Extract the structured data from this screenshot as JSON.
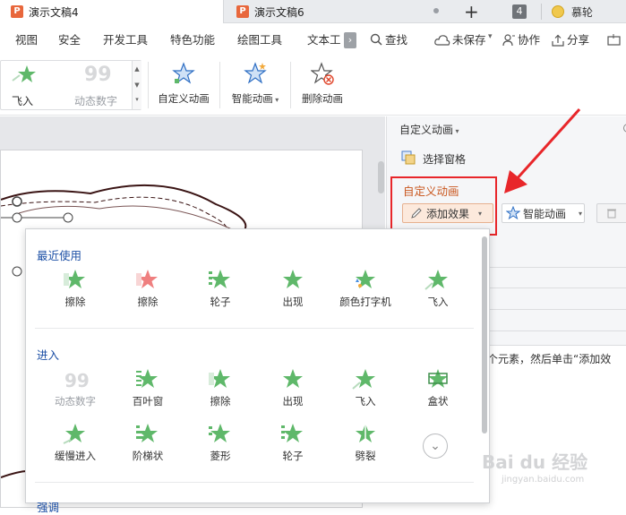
{
  "tabs": {
    "tab1": "演示文稿4",
    "tab2": "演示文稿6",
    "add": "+",
    "count": "4",
    "user": "慕轮"
  },
  "menu": {
    "view": "视图",
    "security": "安全",
    "devtools": "开发工具",
    "special": "特色功能",
    "drawing": "绘图工具",
    "texttools": "文本工",
    "search": "查找",
    "unsaved": "未保存",
    "collab": "协作",
    "share": "分享"
  },
  "ribbon": {
    "fly_in": "飞入",
    "dynamic_number": "动态数字",
    "custom_anim": "自定义动画",
    "smart_anim": "智能动画",
    "delete_anim": "删除动画"
  },
  "panel": {
    "title": "自定义动画",
    "select_pane": "选择窗格",
    "section_title": "自定义动画",
    "add_effect": "添加效果",
    "smart_anim": "智能动画",
    "hint": "个元素，然后单击“添加效"
  },
  "dropdown": {
    "recent_title": "最近使用",
    "recent": [
      {
        "label": "擦除",
        "icon": "wipe-icon"
      },
      {
        "label": "擦除",
        "icon": "wipe-red-icon"
      },
      {
        "label": "轮子",
        "icon": "wheel-icon"
      },
      {
        "label": "出现",
        "icon": "appear-icon"
      },
      {
        "label": "颜色打字机",
        "icon": "color-typewriter-icon"
      },
      {
        "label": "飞入",
        "icon": "fly-in-icon"
      }
    ],
    "enter_title": "进入",
    "enter_row1": [
      {
        "label": "动态数字",
        "icon": "dynamic-number-icon"
      },
      {
        "label": "百叶窗",
        "icon": "blinds-icon"
      },
      {
        "label": "擦除",
        "icon": "wipe-icon"
      },
      {
        "label": "出现",
        "icon": "appear-icon"
      },
      {
        "label": "飞入",
        "icon": "fly-in-icon"
      },
      {
        "label": "盒状",
        "icon": "box-icon"
      }
    ],
    "enter_row2": [
      {
        "label": "缓慢进入",
        "icon": "slow-enter-icon"
      },
      {
        "label": "阶梯状",
        "icon": "steps-icon"
      },
      {
        "label": "菱形",
        "icon": "diamond-icon"
      },
      {
        "label": "轮子",
        "icon": "wheel-icon"
      },
      {
        "label": "劈裂",
        "icon": "split-icon"
      }
    ],
    "more_title": "强调"
  },
  "watermark": {
    "brand": "Bai du 经验",
    "url": "jingyan.baidu.com"
  },
  "colors": {
    "accent": "#c9571e",
    "highlight": "#e8262a",
    "section": "#1c4fa5",
    "star": "#5fb86a"
  }
}
